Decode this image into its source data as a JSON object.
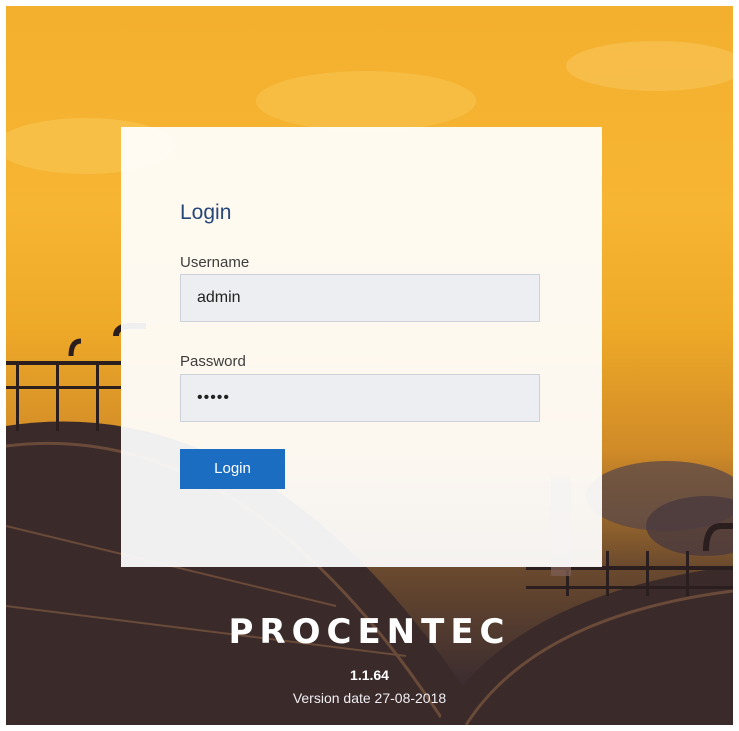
{
  "login": {
    "title": "Login",
    "username_label": "Username",
    "username_value": "admin",
    "password_label": "Password",
    "password_value": "•••••",
    "button_label": "Login"
  },
  "footer": {
    "brand": "PROCENTEC",
    "version": "1.1.64",
    "version_date": "Version date 27-08-2018"
  },
  "colors": {
    "accent": "#1a6dc0",
    "title": "#26477a",
    "sky": "#f3b02e"
  }
}
